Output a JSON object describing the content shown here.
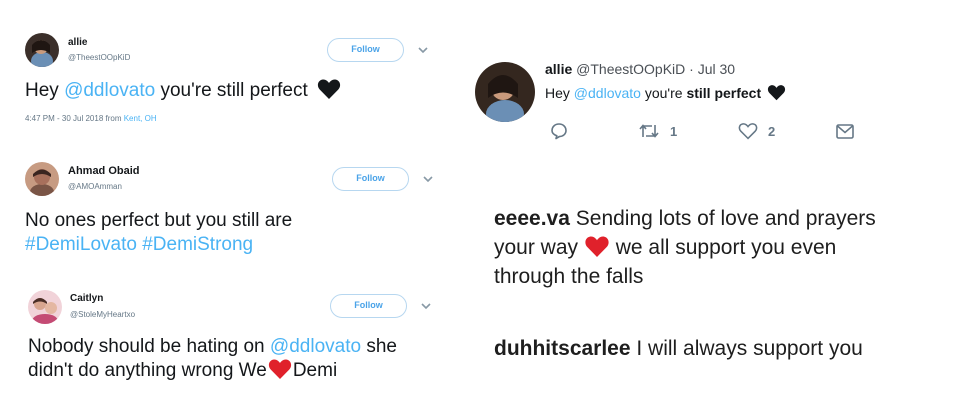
{
  "tweets": [
    {
      "name": "allie",
      "handle": "@TheestOOpKiD",
      "follow_label": "Follow",
      "text_pre": "Hey ",
      "mention": "@ddlovato",
      "text_post": " you're still perfect",
      "time": "4:47 PM - 30 Jul 2018 from ",
      "place": "Kent, OH"
    },
    {
      "name": "Ahmad Obaid",
      "handle": "@AMOAmman",
      "follow_label": "Follow",
      "line1": "No ones perfect but you still are",
      "hashtags": "#DemiLovato #DemiStrong"
    },
    {
      "name": "Caitlyn",
      "handle": "@StoleMyHeartxo",
      "follow_label": "Follow",
      "line1_pre": "Nobody should be hating on ",
      "line1_mention": "@ddlovato",
      "line1_post": " she",
      "line2_pre": "didn't do anything wrong We",
      "line2_post": "Demi"
    }
  ],
  "right_tweet": {
    "name": "allie",
    "handle_date": "@TheestOOpKiD · Jul 30",
    "text_pre": "Hey ",
    "mention": "@ddlovato",
    "text_mid": " you're ",
    "text_bold": "still perfect",
    "retweets": "1",
    "likes": "2"
  },
  "instagram_comments": [
    {
      "user": "eeee.va",
      "line1": " Sending lots of love and prayers",
      "line2_pre": "your way ",
      "line2_post": " we all support you even",
      "line3": "through the falls"
    },
    {
      "user": "duhhitscarlee",
      "text": " I will always support you"
    }
  ],
  "colors": {
    "link": "#4ab3f4",
    "black_heart": "#14171a",
    "red_heart": "#e0212b",
    "follow_border": "#b7d7f0"
  },
  "icons": [
    "black-heart-icon",
    "red-heart-icon",
    "reply-icon",
    "retweet-icon",
    "like-icon",
    "message-icon",
    "chevron-down-icon"
  ]
}
